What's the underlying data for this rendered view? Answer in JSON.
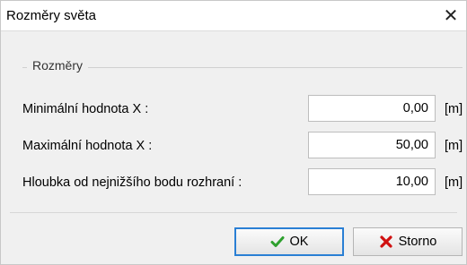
{
  "window": {
    "title": "Rozměry světa",
    "close_glyph": "✕"
  },
  "group": {
    "legend": "Rozměry"
  },
  "fields": [
    {
      "label": "Minimální hodnota X :",
      "value": "0,00",
      "unit": "[m]"
    },
    {
      "label": "Maximální hodnota X :",
      "value": "50,00",
      "unit": "[m]"
    },
    {
      "label": "Hloubka od nejnižšího bodu rozhraní :",
      "value": "10,00",
      "unit": "[m]"
    }
  ],
  "buttons": {
    "ok_label": "OK",
    "ok_icon": "check-icon",
    "ok_icon_color": "#2ea02e",
    "cancel_label": "Storno",
    "cancel_icon": "x-icon",
    "cancel_icon_color": "#d01010"
  },
  "colors": {
    "focus_border": "#2a7fd4"
  }
}
